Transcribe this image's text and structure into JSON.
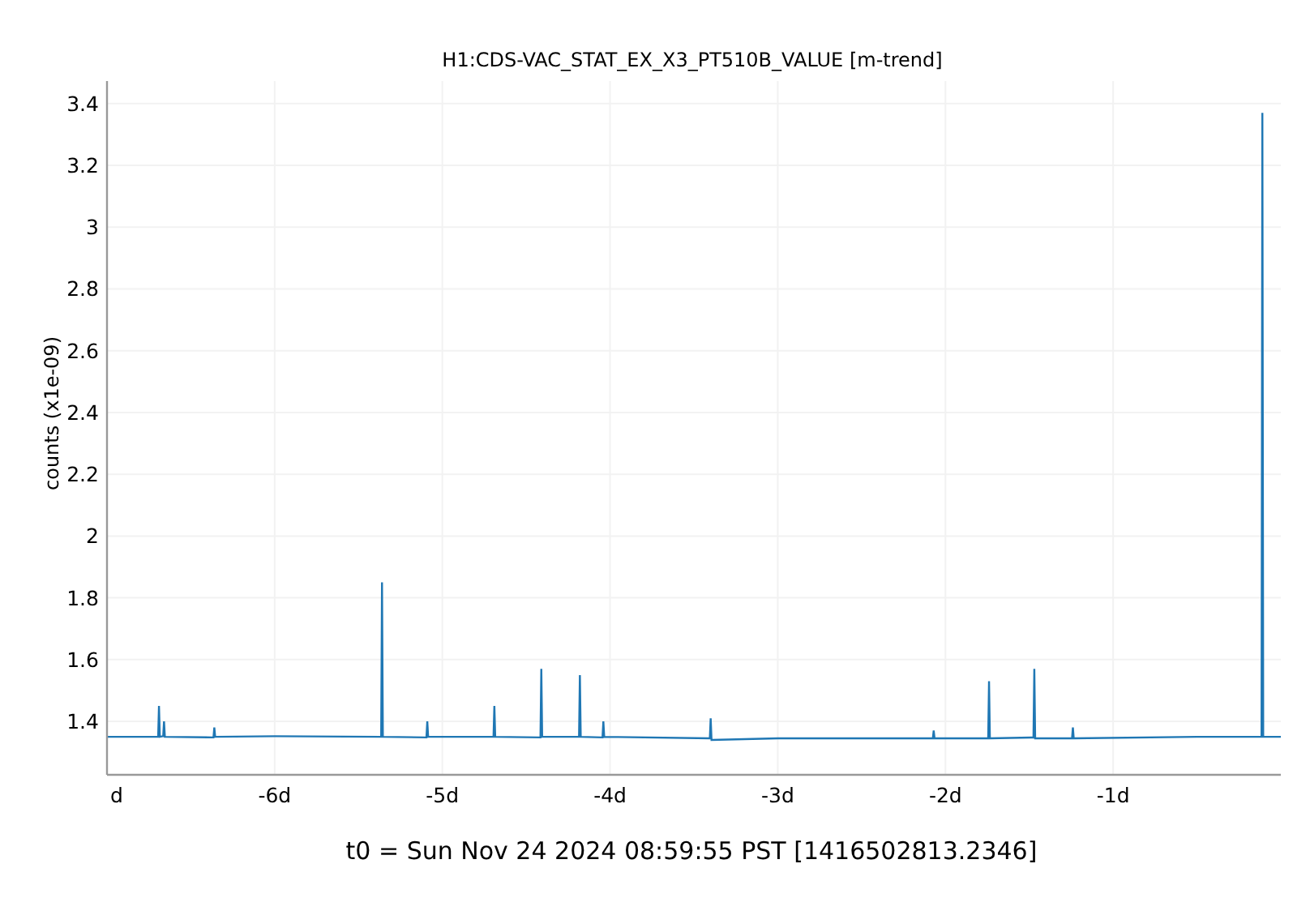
{
  "plot": {
    "chart_data": {
      "type": "line",
      "title": "H1:CDS-VAC_STAT_EX_X3_PT510B_VALUE [m-trend]",
      "ylabel": "counts (x1e-09)",
      "xlim": [
        -7,
        0
      ],
      "ylim": [
        1.227,
        3.473
      ],
      "xticks": [
        {
          "value": -7,
          "label": "d"
        },
        {
          "value": -6,
          "label": "-6d"
        },
        {
          "value": -5,
          "label": "-5d"
        },
        {
          "value": -4,
          "label": "-4d"
        },
        {
          "value": -3,
          "label": "-3d"
        },
        {
          "value": -2,
          "label": "-2d"
        },
        {
          "value": -1,
          "label": "-1d"
        }
      ],
      "yticks": [
        1.4,
        1.6,
        1.8,
        2,
        2.2,
        2.4,
        2.6,
        2.8,
        3,
        3.2,
        3.4
      ],
      "grid": true,
      "x": [
        -7,
        -6.695,
        -6.69,
        -6.685,
        -6.665,
        -6.66,
        -6.655,
        -6.365,
        -6.36,
        -6.355,
        -6,
        -5.365,
        -5.36,
        -5.355,
        -5.095,
        -5.09,
        -5.085,
        -4.695,
        -4.69,
        -4.685,
        -4.415,
        -4.41,
        -4.405,
        -4.185,
        -4.18,
        -4.175,
        -4.045,
        -4.04,
        -4.035,
        -3.405,
        -3.4,
        -3.395,
        -3,
        -2.075,
        -2.07,
        -2.065,
        -1.745,
        -1.74,
        -1.735,
        -1.475,
        -1.47,
        -1.465,
        -1.245,
        -1.24,
        -1.235,
        -0.5,
        -0.115,
        -0.11,
        -0.105,
        0
      ],
      "series": [
        {
          "color": "#1f77b4",
          "values": [
            1.35,
            1.35,
            1.45,
            1.35,
            1.352,
            1.4,
            1.35,
            1.348,
            1.38,
            1.35,
            1.352,
            1.35,
            1.85,
            1.35,
            1.348,
            1.4,
            1.35,
            1.35,
            1.45,
            1.35,
            1.348,
            1.57,
            1.35,
            1.35,
            1.55,
            1.35,
            1.348,
            1.4,
            1.35,
            1.345,
            1.41,
            1.34,
            1.345,
            1.345,
            1.37,
            1.345,
            1.345,
            1.53,
            1.345,
            1.348,
            1.57,
            1.345,
            1.345,
            1.38,
            1.345,
            1.35,
            1.35,
            3.37,
            1.35,
            1.35
          ]
        }
      ]
    }
  },
  "footer": {
    "t0": "t0 = Sun Nov 24 2024 08:59:55 PST [1416502813.2346]"
  }
}
